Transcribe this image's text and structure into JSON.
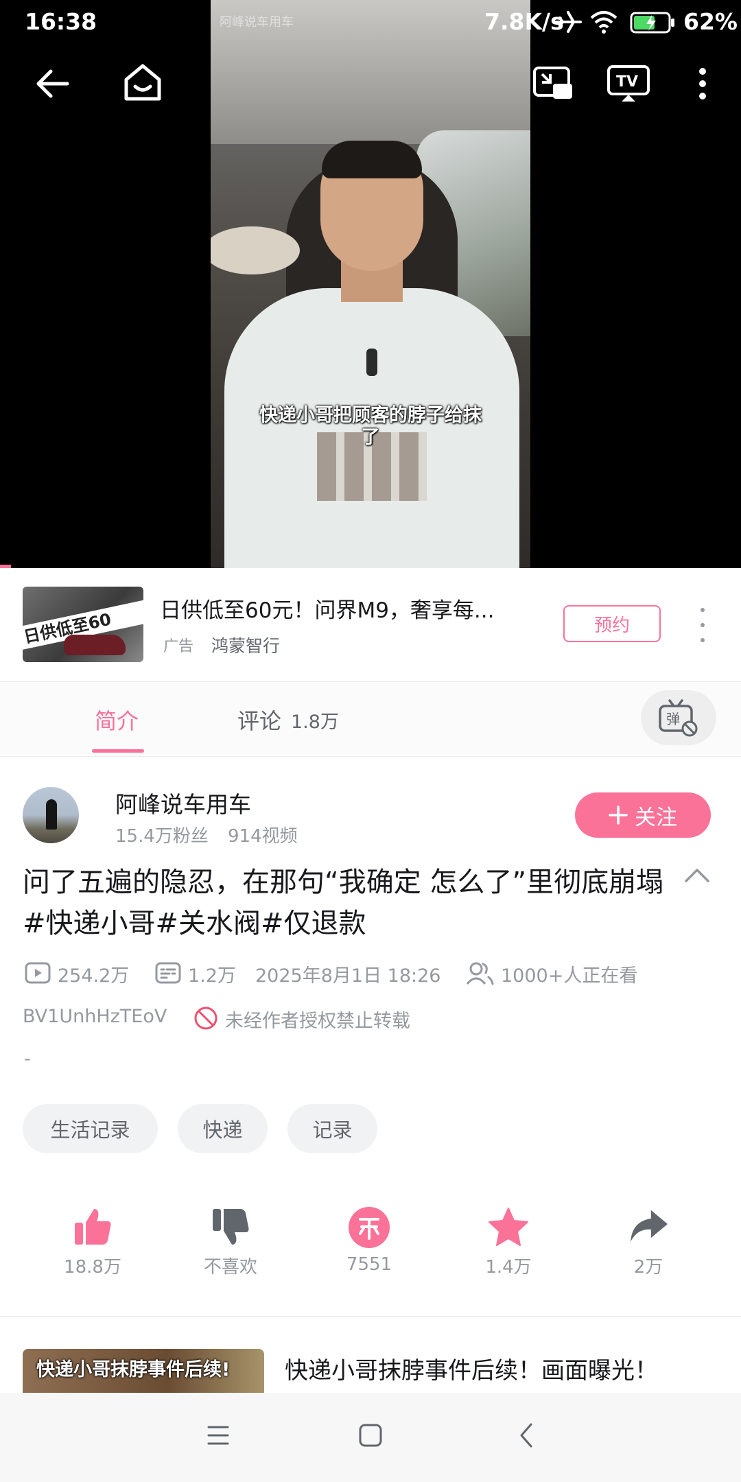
{
  "status_bar": {
    "time": "16:38",
    "speed": "7.8K/s",
    "battery": "62%"
  },
  "video": {
    "watermark": "阿峰说车用车",
    "subtitle_line1": "快递小哥把顾客的脖子给抹",
    "subtitle_line2": "了",
    "icons": [
      "back-icon",
      "home-icon",
      "pip-icon",
      "tv-cast-icon",
      "more-vertical-icon"
    ]
  },
  "ad": {
    "thumb_text": "日供低至60",
    "title": "日供低至60元！问界M9，奢享每...",
    "tag": "广告",
    "brand": "鸿蒙智行",
    "button": "预约"
  },
  "tabs": {
    "intro": "简介",
    "comments": "评论",
    "comments_count": "1.8万"
  },
  "author": {
    "name": "阿峰说车用车",
    "fans": "15.4万粉丝",
    "videos": "914视频",
    "follow_label": "关注"
  },
  "video_info": {
    "title": "问了五遍的隐忍，在那句“我确定 怎么了”里彻底崩塌#快递小哥#关水阀#仅退款",
    "views": "254.2万",
    "danmaku_count": "1.2万",
    "date": "2025年8月1日 18:26",
    "watching": "1000+人正在看",
    "bvid": "BV1UnhHzTEoV",
    "no_repost": "未经作者授权禁止转载",
    "desc": "-"
  },
  "tags": [
    "生活记录",
    "快递",
    "记录"
  ],
  "actions": {
    "like": "18.8万",
    "dislike": "不喜欢",
    "coin": "7551",
    "favorite": "1.4万",
    "share": "2万"
  },
  "related": {
    "thumb_text": "快递小哥抹脖事件后续!",
    "title": "快递小哥抹脖事件后续！画面曝光！"
  },
  "colors": {
    "accent": "#fb7299",
    "text_primary": "#18191c",
    "text_secondary": "#9499a0"
  }
}
